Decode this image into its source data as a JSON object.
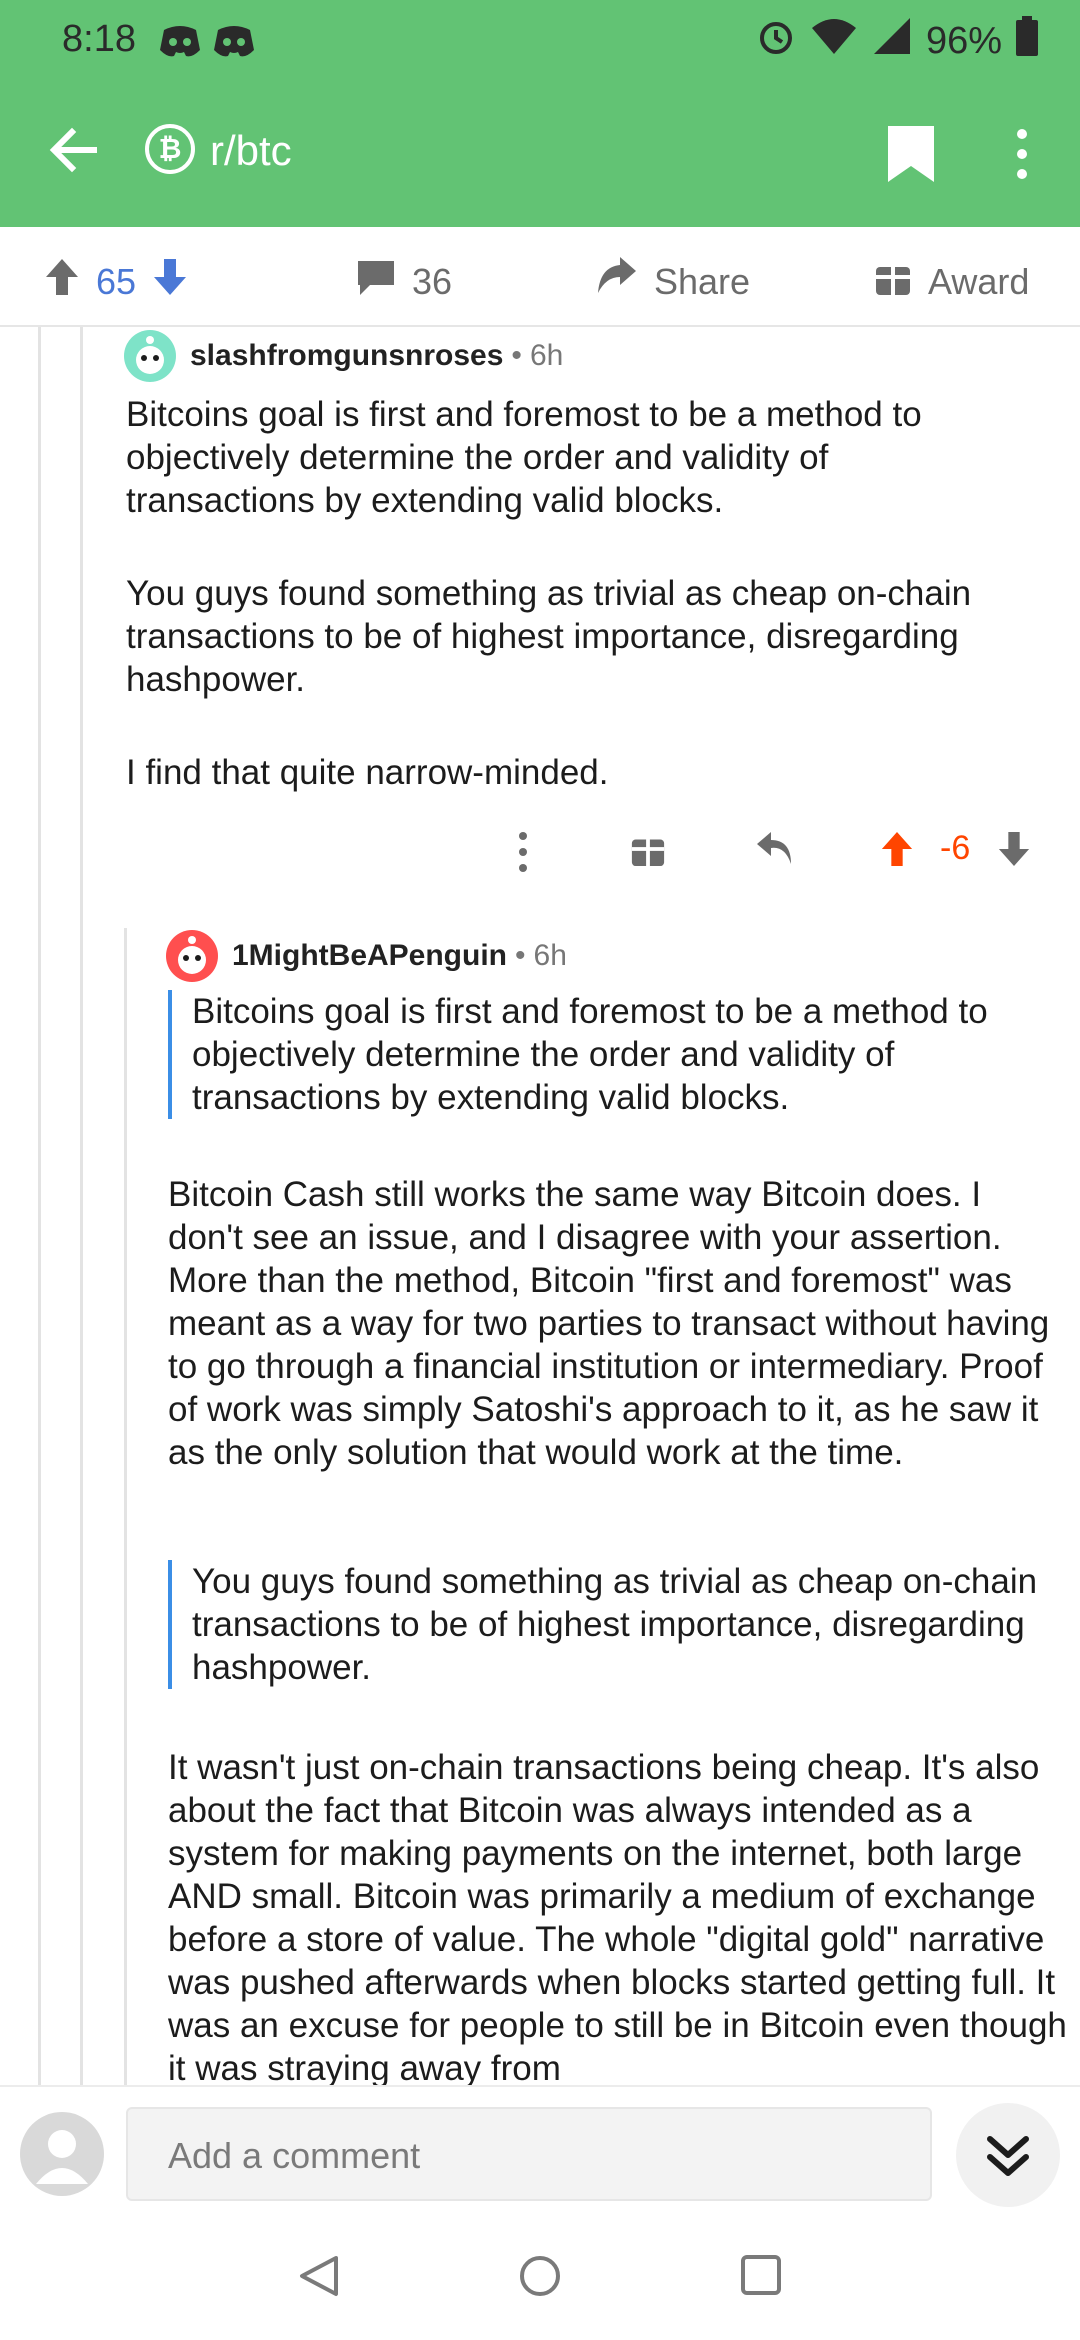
{
  "status_bar": {
    "time": "8:18",
    "battery": "96%",
    "icons": [
      "discord-icon",
      "discord-icon",
      "alarm-icon",
      "wifi-icon",
      "signal-icon",
      "battery-icon"
    ]
  },
  "app_bar": {
    "subreddit": "r/btc",
    "subreddit_icon": "bitcoin-icon",
    "color": "#62c374"
  },
  "action_bar": {
    "votes": "65",
    "comments": "36",
    "share_label": "Share",
    "award_label": "Award"
  },
  "comments": [
    {
      "author": "slashfromgunsnroses",
      "time": "6h",
      "paragraphs": [
        "Bitcoins goal is first and foremost to be a method to objectively determine the order and validity of transactions by extending valid blocks.",
        "You guys found something as trivial as cheap on-chain transactions to be of highest importance, disregarding hashpower.",
        "I find that quite narrow-minded."
      ],
      "score": "-6"
    },
    {
      "author": "1MightBeAPenguin",
      "time": "6h",
      "quote1": "Bitcoins goal is first and foremost to be a method to objectively determine the order and validity of transactions by extending valid blocks.",
      "para1": "Bitcoin Cash still works the same way Bitcoin does. I don't see an issue, and I disagree with your assertion. More than the method, Bitcoin \"first and foremost\" was meant as a way for two parties to transact without having to go through a financial institution or intermediary. Proof of work was simply Satoshi's approach to it, as he saw it as the only solution that would work at the time.",
      "quote2": "You guys found something as trivial as cheap on-chain transactions to be of highest importance, disregarding hashpower.",
      "para2": "It wasn't just on-chain transactions being cheap. It's also about the fact that Bitcoin was always intended as a system for making payments on the internet, both large AND small. Bitcoin was primarily a medium of exchange before a store of value. The whole \"digital gold\" narrative was pushed afterwards when blocks started getting full. It was an excuse for people to still be in Bitcoin even though it was straying away from"
    }
  ],
  "composer": {
    "placeholder": "Add a comment"
  },
  "colors": {
    "upvote": "#ff4500",
    "vote_blue": "#4a78d6",
    "quote_bar": "#3b8ee6"
  }
}
